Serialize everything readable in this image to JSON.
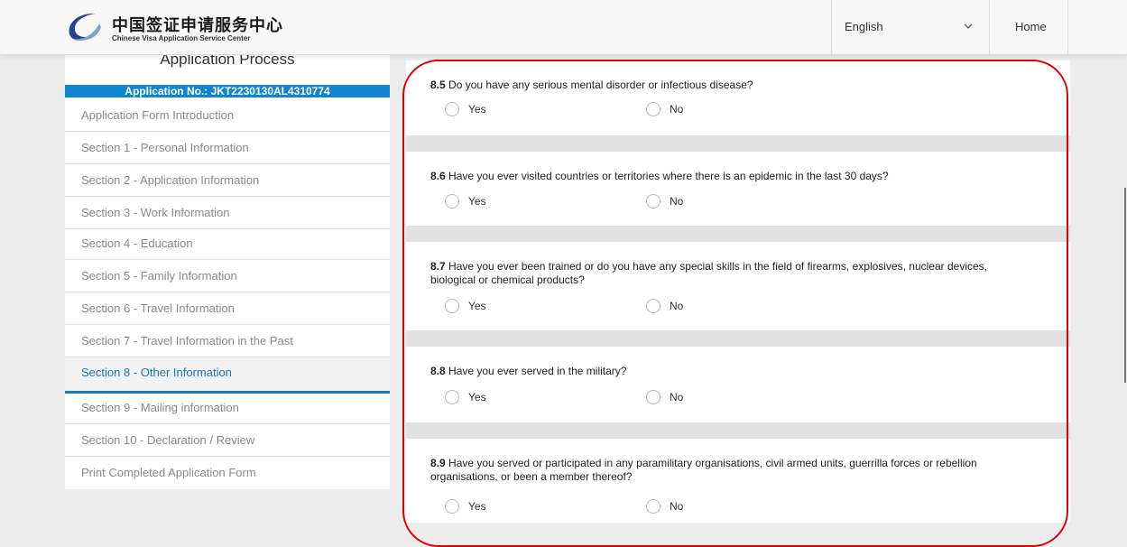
{
  "header": {
    "logo_cn": "中国签证申请服务中心",
    "logo_en": "Chinese Visa Application Service Center",
    "language": "English",
    "home": "Home"
  },
  "sidebar": {
    "title": "Application Process",
    "application_no": "Application No.: JKT2230130AL4310774",
    "items": [
      {
        "label": "Application Form Introduction"
      },
      {
        "label": "Section 1 - Personal Information"
      },
      {
        "label": "Section 2 - Application Information"
      },
      {
        "label": "Section 3 - Work Information"
      },
      {
        "label": "Section 4 - Education"
      },
      {
        "label": "Section 5 - Family Information"
      },
      {
        "label": "Section 6 - Travel Information"
      },
      {
        "label": "Section 7 - Travel Information in the Past"
      },
      {
        "label": "Section 8 - Other Information"
      },
      {
        "label": "Section 9 - Mailing information"
      },
      {
        "label": "Section 10 - Declaration / Review"
      },
      {
        "label": "Print Completed Application Form"
      }
    ]
  },
  "questions": [
    {
      "num": "8.5",
      "text": "Do you have any serious mental disorder or infectious disease?",
      "yes": "Yes",
      "no": "No"
    },
    {
      "num": "8.6",
      "text": "Have you ever visited countries or territories where there is an epidemic in the last 30 days?",
      "yes": "Yes",
      "no": "No"
    },
    {
      "num": "8.7",
      "text": "Have you ever been trained or do you have any special skills in the field of firearms, explosives, nuclear devices, biological or chemical products?",
      "yes": "Yes",
      "no": "No"
    },
    {
      "num": "8.8",
      "text": "Have you ever served in the military?",
      "yes": "Yes",
      "no": "No"
    },
    {
      "num": "8.9",
      "text": "Have you served or participated in any paramilitary organisations, civil armed units, guerrilla forces or rebellion organisations, or been a member thereof?",
      "yes": "Yes",
      "no": "No"
    }
  ],
  "colors": {
    "accent": "#1283cf",
    "highlight": "#e00000"
  }
}
